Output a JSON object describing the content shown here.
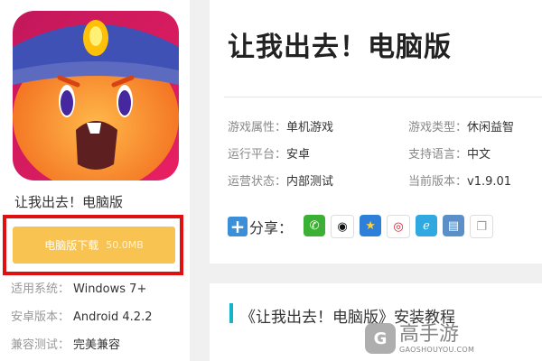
{
  "left": {
    "app_name": "让我出去！电脑版",
    "download": {
      "label": "电脑版下载",
      "size": "50.0MB"
    },
    "specs": [
      {
        "key": "适用系统：",
        "value": "Windows 7+"
      },
      {
        "key": "安卓版本：",
        "value": "Android 4.2.2"
      },
      {
        "key": "兼容测试：",
        "value": "完美兼容"
      }
    ]
  },
  "header": {
    "title": "让我出去！电脑版"
  },
  "attributes": [
    {
      "key": "游戏属性：",
      "value": "单机游戏"
    },
    {
      "key": "游戏类型：",
      "value": "休闲益智"
    },
    {
      "key": "运行平台：",
      "value": "安卓"
    },
    {
      "key": "支持语言：",
      "value": "中文"
    },
    {
      "key": "运营状态：",
      "value": "内部测试"
    },
    {
      "key": "当前版本：",
      "value": "v1.9.01"
    }
  ],
  "share": {
    "label": "分享：",
    "icons": [
      "wechat-icon",
      "qq-icon",
      "qzone-icon",
      "weibo-icon",
      "tencent-weibo-icon",
      "print-icon",
      "copy-icon"
    ]
  },
  "tutorial": {
    "title": "《让我出去！电脑版》安装教程"
  },
  "watermark": {
    "brand": "高手游",
    "domain": "GAOSHOUYOU.COM"
  },
  "colors": {
    "download": "#f9c351",
    "highlight_border": "#e01010",
    "accent_bar": "#17b3c9",
    "share_plus": "#3b8fd9"
  }
}
